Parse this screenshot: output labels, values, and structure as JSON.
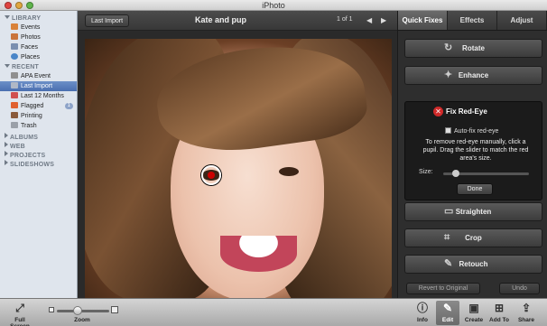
{
  "window": {
    "title": "iPhoto"
  },
  "sidebar": {
    "sections": {
      "library": "LIBRARY",
      "recent": "RECENT",
      "albums": "ALBUMS",
      "web": "WEB",
      "projects": "PROJECTS",
      "slideshows": "SLIDESHOWS"
    },
    "library_items": [
      {
        "label": "Events",
        "icon": "events-icon",
        "color": "#d9823a"
      },
      {
        "label": "Photos",
        "icon": "photos-icon",
        "color": "#c9743b"
      },
      {
        "label": "Faces",
        "icon": "faces-icon",
        "color": "#7a8fb0"
      },
      {
        "label": "Places",
        "icon": "places-icon",
        "color": "#4a86c8"
      }
    ],
    "recent_items": [
      {
        "label": "APA Event",
        "icon": "event-icon",
        "color": "#8f8f8f"
      },
      {
        "label": "Last Import",
        "icon": "import-icon",
        "color": "#b0b8c6"
      },
      {
        "label": "Last 12 Months",
        "icon": "calendar-icon",
        "color": "#d05050"
      },
      {
        "label": "Flagged",
        "icon": "flag-icon",
        "color": "#e06030",
        "badge": "1"
      },
      {
        "label": "Printing",
        "icon": "printer-icon",
        "color": "#8a5a3a"
      },
      {
        "label": "Trash",
        "icon": "trash-icon",
        "color": "#9aa0a8"
      }
    ]
  },
  "toolbar": {
    "last_import": "Last Import",
    "photo_title": "Kate and pup",
    "count": "1 of 1",
    "prev": "◀",
    "next": "▶"
  },
  "tabs": [
    {
      "label": "Quick Fixes",
      "active": true
    },
    {
      "label": "Effects",
      "active": false
    },
    {
      "label": "Adjust",
      "active": false
    }
  ],
  "quick_fixes": {
    "rotate": "Rotate",
    "enhance": "Enhance",
    "fix_redeye": {
      "title": "Fix Red-Eye",
      "auto_fix": "Auto-fix red-eye",
      "instructions": "To remove red-eye manually, click a pupil. Drag the slider to match the red area's size.",
      "size_label": "Size:",
      "size_value": 0.15,
      "done": "Done"
    },
    "straighten": "Straighten",
    "crop": "Crop",
    "retouch": "Retouch",
    "revert": "Revert to Original",
    "undo": "Undo"
  },
  "bottom_bar": {
    "full_screen": "Full Screen",
    "zoom": "Zoom",
    "zoom_level": 0.4,
    "info": "Info",
    "edit": "Edit",
    "create": "Create",
    "add_to": "Add To",
    "share": "Share"
  }
}
